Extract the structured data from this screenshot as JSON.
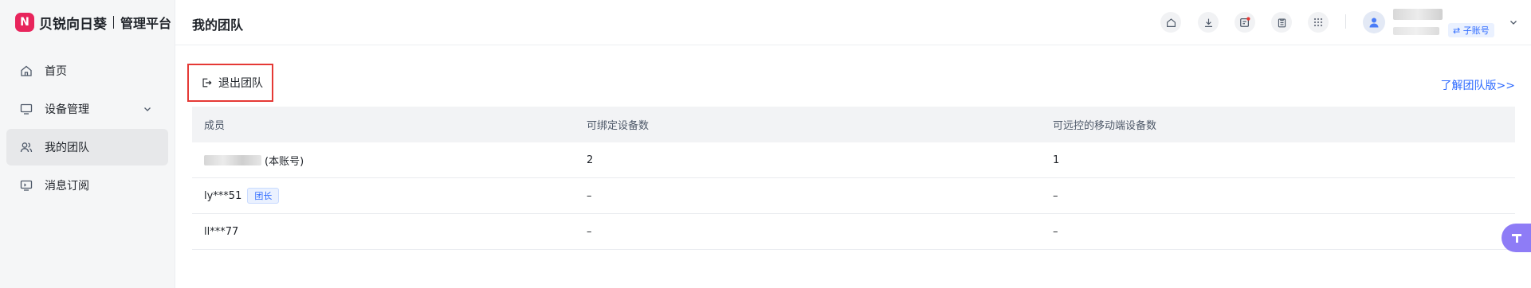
{
  "brand": {
    "mark": "N",
    "name": "贝锐向日葵",
    "subtitle": "管理平台"
  },
  "sidebar": {
    "items": [
      {
        "label": "首页",
        "icon": "home-icon"
      },
      {
        "label": "设备管理",
        "icon": "monitor-icon"
      },
      {
        "label": "我的团队",
        "icon": "users-icon"
      },
      {
        "label": "消息订阅",
        "icon": "message-icon"
      }
    ],
    "active_index": 2
  },
  "header": {
    "title": "我的团队",
    "icons": [
      "home-icon",
      "download-icon",
      "notification-icon",
      "clipboard-icon",
      "apps-grid-icon"
    ],
    "sub_account_label": "⇄ 子账号"
  },
  "main": {
    "exit_team_label": "退出团队",
    "learn_link": "了解团队版>>",
    "table": {
      "headers": [
        "成员",
        "可绑定设备数",
        "可远控的移动端设备数"
      ],
      "rows": [
        {
          "member": "(本账号)",
          "member_blurred": true,
          "badge": "",
          "bindable": "2",
          "mobile": "1"
        },
        {
          "member": "ly***51",
          "member_blurred": false,
          "badge": "团长",
          "bindable": "–",
          "mobile": "–"
        },
        {
          "member": "ll***77",
          "member_blurred": false,
          "badge": "",
          "bindable": "–",
          "mobile": "–"
        }
      ]
    }
  },
  "colors": {
    "accent": "#2f6bff",
    "brand": "#e8255c",
    "highlight_border": "#e53935",
    "float": "#8e7cf6"
  }
}
